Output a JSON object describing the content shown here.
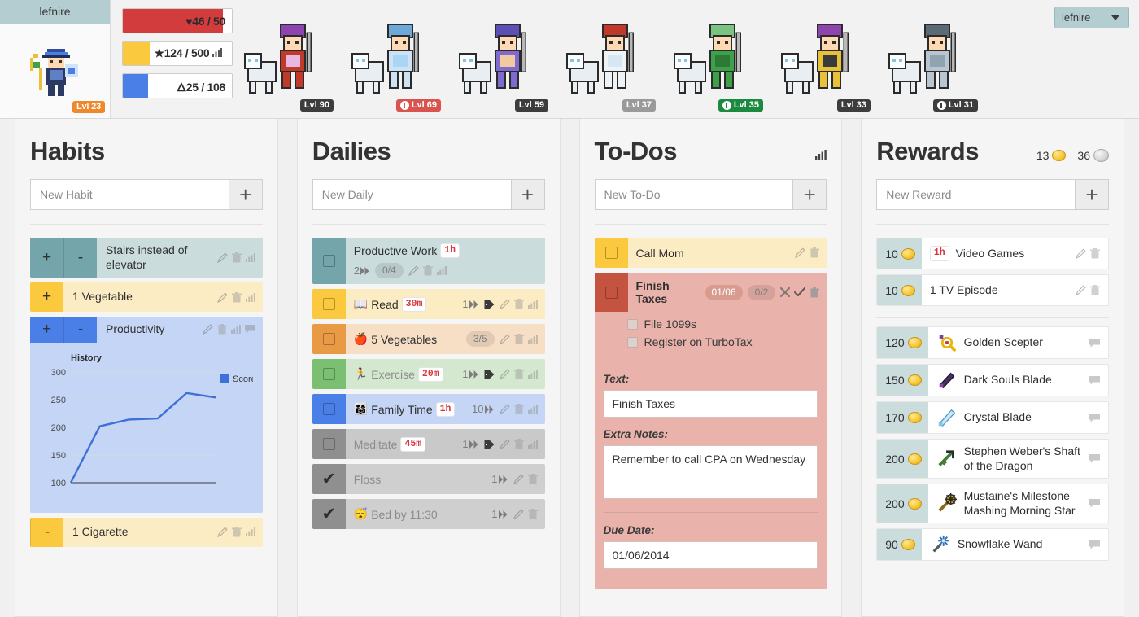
{
  "header": {
    "username": "lefnire",
    "level_badge": "Lvl 23",
    "user_select_value": "lefnire",
    "stats": [
      {
        "name": "health",
        "icon": "heart-icon",
        "label": "46 / 50",
        "current": 46,
        "max": 50,
        "percent": 92,
        "color": "#d33c3c"
      },
      {
        "name": "experience",
        "icon": "star-icon",
        "label": "124 / 500",
        "current": 124,
        "max": 500,
        "percent": 24.8,
        "color": "#fbc93d"
      },
      {
        "name": "mana",
        "icon": "flame-icon",
        "label": "25 / 108",
        "current": 25,
        "max": 108,
        "percent": 23.1,
        "color": "#4a7fe8"
      }
    ],
    "party": [
      {
        "level": "Lvl 90",
        "badge_style": "dark",
        "boss": false
      },
      {
        "level": "Lvl 69",
        "badge_style": "red",
        "boss": true
      },
      {
        "level": "Lvl 59",
        "badge_style": "dark",
        "boss": false
      },
      {
        "level": "Lvl 37",
        "badge_style": "gray",
        "boss": false
      },
      {
        "level": "Lvl 35",
        "badge_style": "green",
        "boss": true
      },
      {
        "level": "Lvl 33",
        "badge_style": "dark",
        "boss": false
      },
      {
        "level": "Lvl 31",
        "badge_style": "dark",
        "boss": true
      }
    ]
  },
  "habits": {
    "title": "Habits",
    "placeholder": "New Habit",
    "add_label": "+",
    "items": [
      {
        "text": "Stairs instead of elevator",
        "color": "teal",
        "plus": true,
        "minus": true,
        "plus_label": "+",
        "minus_label": "-"
      },
      {
        "text": "1 Vegetable",
        "color": "yellow",
        "plus": true,
        "minus": false,
        "plus_label": "+",
        "minus_label": "-"
      },
      {
        "text": "Productivity",
        "color": "blue",
        "plus": true,
        "minus": true,
        "plus_label": "+",
        "minus_label": "-",
        "expanded": true
      },
      {
        "text": "1 Cigarette",
        "color": "yellow",
        "plus": false,
        "minus": true,
        "plus_label": "+",
        "minus_label": "-"
      }
    ]
  },
  "chart_data": {
    "type": "line",
    "title": "History",
    "legend": [
      "Score"
    ],
    "legend_position": "right",
    "series": [
      {
        "name": "Score",
        "color": "#3f6fd8",
        "values": [
          100,
          202,
          214,
          216,
          262,
          254
        ]
      }
    ],
    "x": [
      0,
      1,
      2,
      3,
      4,
      5
    ],
    "ylim": [
      100,
      300
    ],
    "yticks": [
      100,
      150,
      200,
      250,
      300
    ],
    "ytick_labels": [
      "100",
      "150",
      "200",
      "250",
      "300"
    ],
    "xlabel": "",
    "ylabel": "",
    "grid": true
  },
  "dailies": {
    "title": "Dailies",
    "placeholder": "New Daily",
    "add_label": "+",
    "items": [
      {
        "emoji": "",
        "text": "Productive Work",
        "time": "1h",
        "color": "teal",
        "checked": false,
        "streak": "2",
        "count": "0/4",
        "dim": false,
        "tag": false
      },
      {
        "emoji": "📖",
        "text": "Read",
        "time": "30m",
        "color": "yellow",
        "checked": false,
        "streak": "1",
        "count": "",
        "dim": false,
        "tag": true
      },
      {
        "emoji": "🍎",
        "text": "5 Vegetables",
        "time": "",
        "color": "orange",
        "checked": false,
        "streak": "",
        "count": "3/5",
        "dim": false,
        "tag": false
      },
      {
        "emoji": "🏃",
        "text": "Exercise",
        "time": "20m",
        "color": "green",
        "checked": false,
        "streak": "1",
        "count": "",
        "dim": true,
        "tag": true
      },
      {
        "emoji": "👨‍👩‍👧",
        "text": "Family Time",
        "time": "1h",
        "color": "blue",
        "checked": false,
        "streak": "10",
        "count": "",
        "dim": false,
        "tag": false
      },
      {
        "emoji": "",
        "text": "Meditate",
        "time": "45m",
        "color": "gray",
        "checked": false,
        "streak": "1",
        "count": "",
        "dim": true,
        "tag": true
      },
      {
        "emoji": "",
        "text": "Floss",
        "time": "",
        "color": "gray2",
        "checked": true,
        "streak": "1",
        "count": "",
        "dim": true,
        "tag": false
      },
      {
        "emoji": "😴",
        "text": "Bed by 11:30",
        "time": "",
        "color": "gray2",
        "checked": true,
        "streak": "1",
        "count": "",
        "dim": true,
        "tag": false
      }
    ]
  },
  "todos": {
    "title": "To-Dos",
    "placeholder": "New To-Do",
    "add_label": "+",
    "items": [
      {
        "text": "Call Mom",
        "color": "yellow",
        "due": "",
        "count": "",
        "checked": false,
        "expanded": false
      },
      {
        "text": "Finish Taxes",
        "color": "red",
        "due": "01/06",
        "count": "0/2",
        "checked": false,
        "expanded": true
      }
    ],
    "checklist": [
      {
        "label": "File 1099s",
        "done": false
      },
      {
        "label": "Register on TurboTax",
        "done": false
      }
    ],
    "form": {
      "text_label": "Text:",
      "text_value": "Finish Taxes",
      "notes_label": "Extra Notes:",
      "notes_value": "Remember to call CPA on Wednesday",
      "due_label": "Due Date:",
      "due_value": "01/06/2014"
    }
  },
  "rewards": {
    "title": "Rewards",
    "placeholder": "New Reward",
    "add_label": "+",
    "gold": "13",
    "silver": "36",
    "user_items": [
      {
        "cost": "10",
        "text": "Video Games",
        "time": "1h",
        "icon": ""
      },
      {
        "cost": "10",
        "text": "1 TV Episode",
        "time": "",
        "icon": ""
      }
    ],
    "shop_items": [
      {
        "cost": "120",
        "text": "Golden Scepter",
        "icon": "golden-scepter-icon"
      },
      {
        "cost": "150",
        "text": "Dark Souls Blade",
        "icon": "dark-souls-blade-icon"
      },
      {
        "cost": "170",
        "text": "Crystal Blade",
        "icon": "crystal-blade-icon"
      },
      {
        "cost": "200",
        "text": "Stephen Weber's Shaft of the Dragon",
        "icon": "dragon-shaft-icon"
      },
      {
        "cost": "200",
        "text": "Mustaine's Milestone Mashing Morning Star",
        "icon": "morning-star-icon"
      },
      {
        "cost": "90",
        "text": "Snowflake Wand",
        "icon": "snowflake-wand-icon"
      }
    ]
  }
}
